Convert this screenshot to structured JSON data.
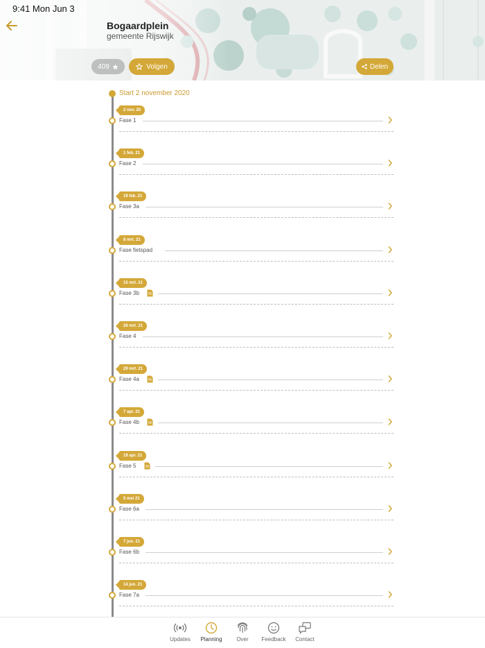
{
  "status_bar": {
    "time": "9:41  Mon Jun 3"
  },
  "header": {
    "title": "Bogaardplein",
    "subtitle": "gemeente Rijswijk",
    "follower_count": "409",
    "follow_label": "Volgen",
    "share_label": "Delen",
    "accent": "#d4a838"
  },
  "timeline": {
    "start_label": "Start 2 november 2020",
    "items": [
      {
        "date": "2 nov. 20",
        "label": "Fase 1",
        "has_doc": false
      },
      {
        "date": "1 feb. 21",
        "label": "Fase 2",
        "has_doc": false
      },
      {
        "date": "19 feb. 21",
        "label": "Fase 3a",
        "has_doc": false
      },
      {
        "date": "8 mrt. 21",
        "label": "Fase fietspad",
        "has_doc": false
      },
      {
        "date": "15 mrt. 21",
        "label": "Fase 3b",
        "has_doc": true
      },
      {
        "date": "26 mrt. 21",
        "label": "Fase 4",
        "has_doc": false
      },
      {
        "date": "29 mrt. 21",
        "label": "Fase 4a",
        "has_doc": true
      },
      {
        "date": "7 apr. 21",
        "label": "Fase 4b",
        "has_doc": true
      },
      {
        "date": "19 apr. 21",
        "label": "Fase 5",
        "has_doc": true
      },
      {
        "date": "5 mei 21",
        "label": "Fase 6a",
        "has_doc": false
      },
      {
        "date": "7 jun. 21",
        "label": "Fase 6b",
        "has_doc": false
      },
      {
        "date": "14 jun. 21",
        "label": "Fase 7a",
        "has_doc": false
      }
    ]
  },
  "tabs": [
    {
      "label": "Updates",
      "icon": "broadcast-icon",
      "active": false
    },
    {
      "label": "Planning",
      "icon": "clock-icon",
      "active": true
    },
    {
      "label": "Over",
      "icon": "fingerprint-icon",
      "active": false
    },
    {
      "label": "Feedback",
      "icon": "smiley-icon",
      "active": false
    },
    {
      "label": "Contact",
      "icon": "chat-icon",
      "active": false
    }
  ]
}
